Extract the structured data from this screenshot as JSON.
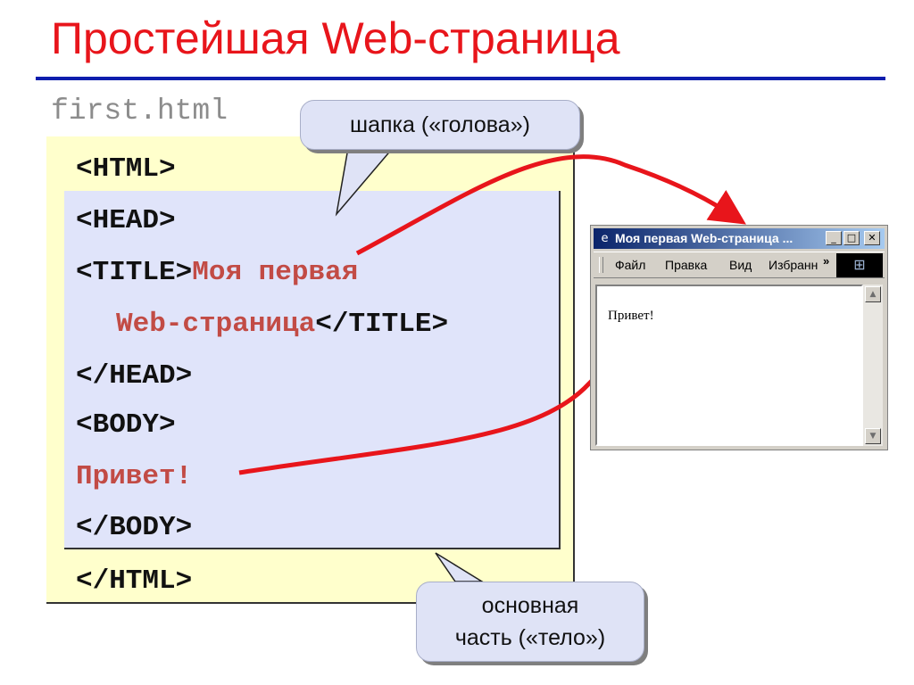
{
  "slide": {
    "title": "Простейшая Web-страница"
  },
  "file": {
    "name": "first.html"
  },
  "code": {
    "html_open": "<HTML>",
    "head_open": "<HEAD>",
    "title_open": "<TITLE>",
    "title_text_line1": "Моя первая",
    "title_text_line2": "Web-страница",
    "title_close": "</TITLE>",
    "head_close": "</HEAD>",
    "body_open": "<BODY>",
    "body_text": "Привет!",
    "body_close": "</BODY>",
    "html_close": "</HTML>"
  },
  "callouts": {
    "head": "шапка («голова»)",
    "body_line1": "основная",
    "body_line2": "часть («тело»)"
  },
  "browser": {
    "window_title": "Моя первая Web-страница ...",
    "controls": {
      "minimize": "_",
      "maximize": "□",
      "close": "✕"
    },
    "menu": [
      "Файл",
      "Правка",
      "Вид",
      "Избранн"
    ],
    "more": "»",
    "content": "Привет!",
    "icons": {
      "app": "ie-icon",
      "logo": "windows-logo-icon",
      "scroll_up": "scroll-up-icon",
      "scroll_down": "scroll-down-icon"
    }
  },
  "colors": {
    "title": "#e8151b",
    "rule": "#0d1dad",
    "file_bg": "#ffffcc",
    "head_bg": "#e0e4fa",
    "tag_text": "#c24b45",
    "arrow": "#e8151b",
    "callout_bg": "#dfe3f6"
  }
}
